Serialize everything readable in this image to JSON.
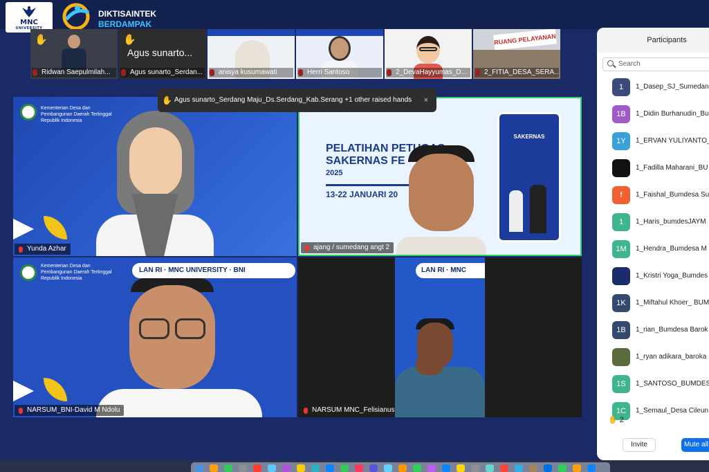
{
  "brand": {
    "mnc_line1": "MNC",
    "mnc_line2": "UNIVERSITY",
    "dikti_line1": "DIKTISAINTEK",
    "dikti_line2": "BERDAMPAK"
  },
  "thumbnails": [
    {
      "name": "Ridwan Saepulmilah...",
      "raised": true,
      "muted": true
    },
    {
      "name": "Agus sunarto_Serdan...",
      "raised": true,
      "muted": true,
      "big_text": "Agus sunarto..."
    },
    {
      "name": "anisya kusumawati",
      "raised": false,
      "muted": true
    },
    {
      "name": "Herri Santoso",
      "raised": false,
      "muted": true
    },
    {
      "name": "2_DevaHayyumas_D...",
      "raised": false,
      "muted": true
    },
    {
      "name": "2_FITIA_DESA_SERA...",
      "raised": false,
      "muted": true,
      "sign": "RUANG PELAYANAN"
    }
  ],
  "toast": {
    "text": "Agus sunarto_Serdang Maju_Ds.Serdang_Kab.Serang +1 other raised hands",
    "close": "×"
  },
  "tiles": {
    "yunda": {
      "label": "Yunda Azhar",
      "org": [
        "Kementerian Desa dan",
        "Pembangunan Daerah Tertinggal",
        "Republik Indonesia"
      ]
    },
    "ajang": {
      "label": "ajang / sumedang angt 2",
      "slide_line1": "PELATIHAN PETUGAS",
      "slide_line2": "SAKERNAS FE",
      "slide_year": "2025",
      "slide_date": "13-22 JANUARI 20",
      "phone_title": "SAKERNAS"
    },
    "david": {
      "label": "NARSUM_BNI-David M Ndolu",
      "org": [
        "Kementerian Desa dan",
        "Pembangunan Daerah Tertinggal",
        "Republik Indonesia"
      ],
      "logos": "LAN RI · MNC UNIVERSITY · BNI"
    },
    "feli": {
      "label": "NARSUM MNC_Felisianus Novandri",
      "logos": "LAN RI · MNC"
    }
  },
  "participants": {
    "title": "Participants",
    "search_placeholder": "Search",
    "items": [
      {
        "initials": "1",
        "color": "#3a4a7a",
        "name": "1_Dasep_SJ_Sumedan"
      },
      {
        "initials": "1B",
        "color": "#a05ac8",
        "name": "1_Didin Burhanudin_Bu"
      },
      {
        "initials": "1Y",
        "color": "#3aa0d8",
        "name": "1_ERVAN YULIYANTO_"
      },
      {
        "initials": "",
        "color": "#111111",
        "name": "1_Fadilla Maharani_BU"
      },
      {
        "initials": "f",
        "color": "#f06030",
        "name": "1_Faishal_Bumdesa Su"
      },
      {
        "initials": "1",
        "color": "#3fb58e",
        "name": "1_Haris_bumdesJAYM"
      },
      {
        "initials": "1M",
        "color": "#3fb58e",
        "name": "1_Hendra_Bumdesa M"
      },
      {
        "initials": "",
        "color": "#1b2b6b",
        "name": "1_Kristri Yoga_Bumdes"
      },
      {
        "initials": "1K",
        "color": "#34496e",
        "name": "1_Miftahul Khoer_ BUM"
      },
      {
        "initials": "1B",
        "color": "#34496e",
        "name": "1_rian_Bumdesa Barok"
      },
      {
        "initials": "",
        "color": "#5a6a3a",
        "name": "1_ryan adikara_baroka"
      },
      {
        "initials": "1S",
        "color": "#3fb58e",
        "name": "1_SANTOSO_BUMDES"
      },
      {
        "initials": "1C",
        "color": "#3fb58e",
        "name": "1_Semaul_Desa Cileun"
      }
    ],
    "raised_count": "2",
    "invite_label": "Invite",
    "mute_all_label": "Mute all"
  }
}
